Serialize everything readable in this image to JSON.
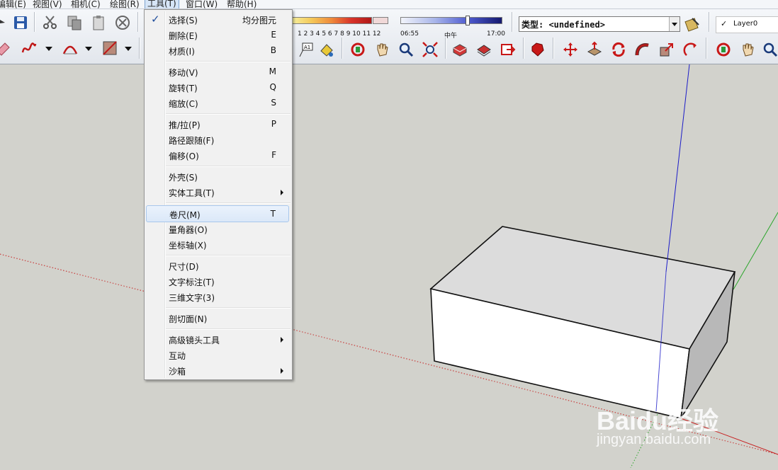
{
  "menubar": {
    "items": [
      {
        "label": "编辑(E)",
        "active": false
      },
      {
        "label": "视图(V)",
        "active": false
      },
      {
        "label": "相机(C)",
        "active": false
      },
      {
        "label": "绘图(R)",
        "active": false
      },
      {
        "label": "工具(T)",
        "active": true
      },
      {
        "label": "窗口(W)",
        "active": false
      },
      {
        "label": "帮助(H)",
        "active": false
      }
    ]
  },
  "toolbar": {
    "shadow_months": "1 2 3 4 5 6 7 8 9 10 11 12",
    "shadow_time": {
      "start": "06:55",
      "mid": "中午",
      "end": "17:00"
    },
    "type_label": "类型: <undefined>",
    "layer_name": "Layer0",
    "layer_check": "✓",
    "icons": {
      "left_top": [
        "cursor-icon",
        "save-icon",
        "cut-icon",
        "copy-icon",
        "paste-icon",
        "erase-circle-icon"
      ],
      "left_bottom": [
        "eraser-icon",
        "freehand-icon",
        "arc-icon",
        "rectangle-icon"
      ],
      "right": [
        "text-label-icon",
        "paint-bucket-icon",
        "orbit-icon",
        "pan-icon",
        "zoom-icon",
        "zoom-extents-icon",
        "component-icon",
        "materials-icon",
        "export-icon",
        "ruby-icon",
        "move-icon",
        "push-pull-icon",
        "rotate-icon",
        "follow-me-icon",
        "scale-icon",
        "offset-icon",
        "orbit-icon-2",
        "pan-icon-2",
        "zoom-icon-2"
      ]
    }
  },
  "tools_menu": {
    "items": [
      {
        "label": "选择(S)",
        "key": "均分图元",
        "checked": true,
        "submenu": false,
        "highlight": false
      },
      {
        "label": "删除(E)",
        "key": "E",
        "checked": false,
        "submenu": false,
        "highlight": false
      },
      {
        "label": "材质(I)",
        "key": "B",
        "checked": false,
        "submenu": false,
        "highlight": false
      },
      {
        "label": "移动(V)",
        "key": "M",
        "checked": false,
        "submenu": false,
        "highlight": false
      },
      {
        "label": "旋转(T)",
        "key": "Q",
        "checked": false,
        "submenu": false,
        "highlight": false
      },
      {
        "label": "缩放(C)",
        "key": "S",
        "checked": false,
        "submenu": false,
        "highlight": false
      },
      {
        "label": "推/拉(P)",
        "key": "P",
        "checked": false,
        "submenu": false,
        "highlight": false
      },
      {
        "label": "路径跟随(F)",
        "key": "",
        "checked": false,
        "submenu": false,
        "highlight": false
      },
      {
        "label": "偏移(O)",
        "key": "F",
        "checked": false,
        "submenu": false,
        "highlight": false
      },
      {
        "label": "外壳(S)",
        "key": "",
        "checked": false,
        "submenu": false,
        "highlight": false
      },
      {
        "label": "实体工具(T)",
        "key": "",
        "checked": false,
        "submenu": true,
        "highlight": false
      },
      {
        "label": "卷尺(M)",
        "key": "T",
        "checked": false,
        "submenu": false,
        "highlight": true
      },
      {
        "label": "量角器(O)",
        "key": "",
        "checked": false,
        "submenu": false,
        "highlight": false
      },
      {
        "label": "坐标轴(X)",
        "key": "",
        "checked": false,
        "submenu": false,
        "highlight": false
      },
      {
        "label": "尺寸(D)",
        "key": "",
        "checked": false,
        "submenu": false,
        "highlight": false
      },
      {
        "label": "文字标注(T)",
        "key": "",
        "checked": false,
        "submenu": false,
        "highlight": false
      },
      {
        "label": "三维文字(3)",
        "key": "",
        "checked": false,
        "submenu": false,
        "highlight": false
      },
      {
        "label": "剖切面(N)",
        "key": "",
        "checked": false,
        "submenu": false,
        "highlight": false
      },
      {
        "label": "高级镜头工具",
        "key": "",
        "checked": false,
        "submenu": true,
        "highlight": false
      },
      {
        "label": "互动",
        "key": "",
        "checked": false,
        "submenu": false,
        "highlight": false
      },
      {
        "label": "沙箱",
        "key": "",
        "checked": false,
        "submenu": true,
        "highlight": false
      }
    ]
  },
  "watermark": {
    "logo": "Baidu经验",
    "url": "jingyan.baidu.com"
  },
  "colors": {
    "axis_red": "#c62020",
    "axis_green": "#2aa52a",
    "axis_blue": "#1c1cc8",
    "viewport_bg": "#d2d2cc"
  }
}
